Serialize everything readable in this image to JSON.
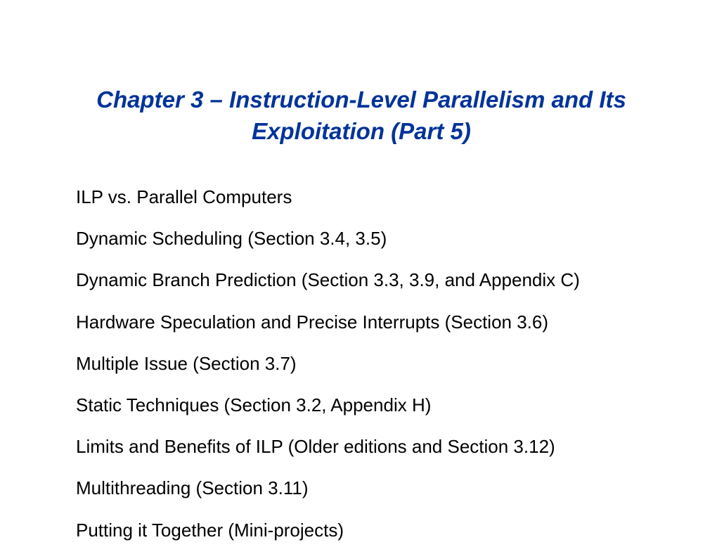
{
  "title": "Chapter 3 – Instruction-Level Parallelism and Its Exploitation (Part 5)",
  "bullets": [
    "ILP vs. Parallel Computers",
    "Dynamic Scheduling (Section 3.4, 3.5)",
    "Dynamic Branch Prediction (Section 3.3, 3.9, and Appendix C)",
    "Hardware Speculation and Precise Interrupts (Section 3.6)",
    "Multiple Issue (Section 3.7)",
    "Static Techniques (Section 3.2, Appendix H)",
    "Limits and Benefits of ILP (Older editions and Section 3.12)",
    "Multithreading (Section 3.11)",
    "Putting it Together (Mini-projects)"
  ]
}
